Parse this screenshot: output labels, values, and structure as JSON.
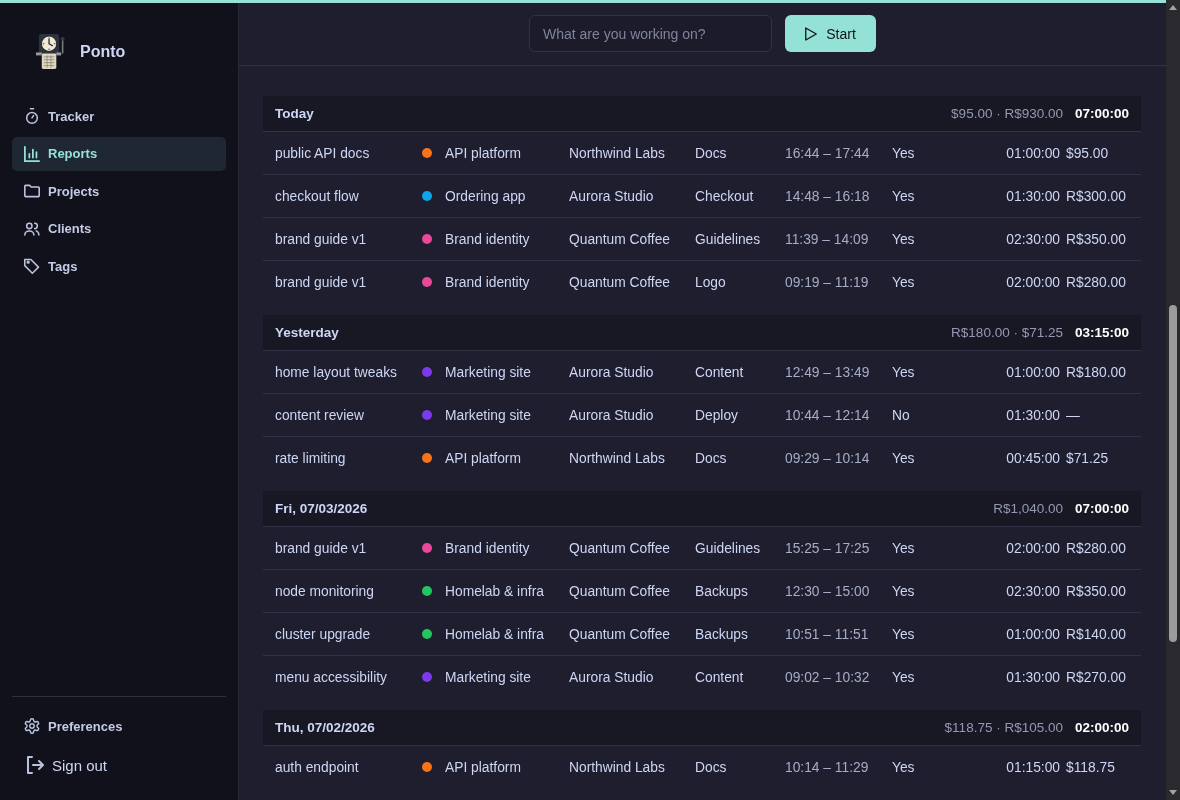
{
  "sidebar": {
    "app_name": "Ponto",
    "nav": [
      {
        "label": "Tracker",
        "selected": false
      },
      {
        "label": "Reports",
        "selected": true
      },
      {
        "label": "Projects",
        "selected": false
      },
      {
        "label": "Clients",
        "selected": false
      },
      {
        "label": "Tags",
        "selected": false
      }
    ],
    "preferences": "Preferences",
    "sign_out": "Sign out"
  },
  "timer": {
    "placeholder": "What are you working on?",
    "button": "Start"
  },
  "days": [
    {
      "title": "Today",
      "amounts": "$95.00 · R$930.00",
      "total": "07:00:00",
      "entries": [
        {
          "description": "public API docs",
          "project": "API platform",
          "color": "#f97316",
          "client": "Northwind Labs",
          "task": "Docs",
          "time_range": "16:44 – 17:44",
          "billable": "Yes",
          "duration": "01:00:00",
          "amount": "$95.00"
        },
        {
          "description": "checkout flow",
          "project": "Ordering app",
          "color": "#0ea5e9",
          "client": "Aurora Studio",
          "task": "Checkout",
          "time_range": "14:48 – 16:18",
          "billable": "Yes",
          "duration": "01:30:00",
          "amount": "R$300.00"
        },
        {
          "description": "brand guide v1",
          "project": "Brand identity",
          "color": "#ec4899",
          "client": "Quantum Coffee",
          "task": "Guidelines",
          "time_range": "11:39 – 14:09",
          "billable": "Yes",
          "duration": "02:30:00",
          "amount": "R$350.00"
        },
        {
          "description": "brand guide v1",
          "project": "Brand identity",
          "color": "#ec4899",
          "client": "Quantum Coffee",
          "task": "Logo",
          "time_range": "09:19 – 11:19",
          "billable": "Yes",
          "duration": "02:00:00",
          "amount": "R$280.00"
        }
      ]
    },
    {
      "title": "Yesterday",
      "amounts": "R$180.00 · $71.25",
      "total": "03:15:00",
      "entries": [
        {
          "description": "home layout tweaks",
          "project": "Marketing site",
          "color": "#7c3aed",
          "client": "Aurora Studio",
          "task": "Content",
          "time_range": "12:49 – 13:49",
          "billable": "Yes",
          "duration": "01:00:00",
          "amount": "R$180.00"
        },
        {
          "description": "content review",
          "project": "Marketing site",
          "color": "#7c3aed",
          "client": "Aurora Studio",
          "task": "Deploy",
          "time_range": "10:44 – 12:14",
          "billable": "No",
          "duration": "01:30:00",
          "amount": "—"
        },
        {
          "description": "rate limiting",
          "project": "API platform",
          "color": "#f97316",
          "client": "Northwind Labs",
          "task": "Docs",
          "time_range": "09:29 – 10:14",
          "billable": "Yes",
          "duration": "00:45:00",
          "amount": "$71.25"
        }
      ]
    },
    {
      "title": "Fri, 07/03/2026",
      "amounts": "R$1,040.00",
      "total": "07:00:00",
      "entries": [
        {
          "description": "brand guide v1",
          "project": "Brand identity",
          "color": "#ec4899",
          "client": "Quantum Coffee",
          "task": "Guidelines",
          "time_range": "15:25 – 17:25",
          "billable": "Yes",
          "duration": "02:00:00",
          "amount": "R$280.00"
        },
        {
          "description": "node monitoring",
          "project": "Homelab & infra",
          "color": "#22c55e",
          "client": "Quantum Coffee",
          "task": "Backups",
          "time_range": "12:30 – 15:00",
          "billable": "Yes",
          "duration": "02:30:00",
          "amount": "R$350.00"
        },
        {
          "description": "cluster upgrade",
          "project": "Homelab & infra",
          "color": "#22c55e",
          "client": "Quantum Coffee",
          "task": "Backups",
          "time_range": "10:51 – 11:51",
          "billable": "Yes",
          "duration": "01:00:00",
          "amount": "R$140.00"
        },
        {
          "description": "menu accessibility",
          "project": "Marketing site",
          "color": "#7c3aed",
          "client": "Aurora Studio",
          "task": "Content",
          "time_range": "09:02 – 10:32",
          "billable": "Yes",
          "duration": "01:30:00",
          "amount": "R$270.00"
        }
      ]
    },
    {
      "title": "Thu, 07/02/2026",
      "amounts": "$118.75 · R$105.00",
      "total": "02:00:00",
      "entries": [
        {
          "description": "auth endpoint",
          "project": "API platform",
          "color": "#f97316",
          "client": "Northwind Labs",
          "task": "Docs",
          "time_range": "10:14 – 11:29",
          "billable": "Yes",
          "duration": "01:15:00",
          "amount": "$118.75"
        }
      ]
    }
  ]
}
